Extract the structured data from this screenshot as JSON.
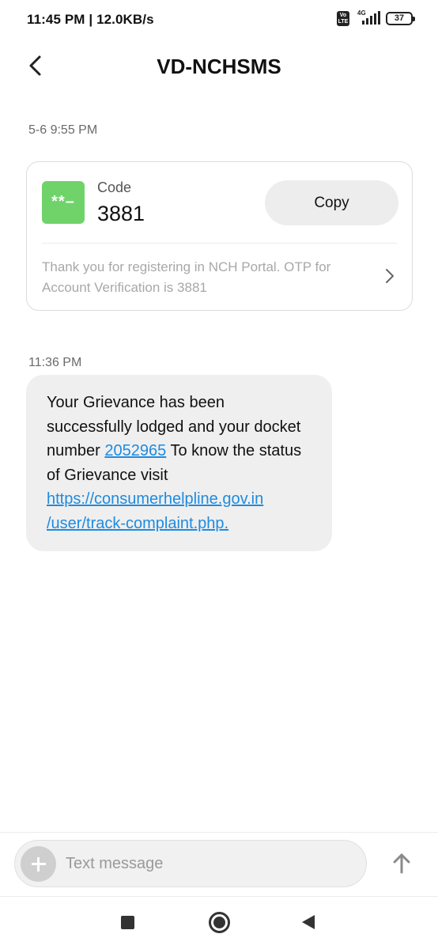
{
  "status_bar": {
    "time_speed": "11:45 PM | 12.0KB/s",
    "volte_label": "Vo LTE",
    "network_label": "4G",
    "battery_level": "37"
  },
  "header": {
    "title": "VD-NCHSMS",
    "back_icon": "chevron-left-icon"
  },
  "messages": [
    {
      "timestamp": "5-6 9:55 PM",
      "otp_card": {
        "icon_text": "**–",
        "icon_color": "#6fd36a",
        "code_label": "Code",
        "code_value": "3881",
        "copy_label": "Copy",
        "body": "Thank you for registering in NCH Portal. OTP for Account Verification is 3881"
      }
    },
    {
      "timestamp": "11:36 PM",
      "text_before_link": "Your Grievance has been successfully lodged and your docket number ",
      "docket_link": "2052965",
      "text_after_link": " To know the status of Grievance visit ",
      "url_line1": "https://consumerhelpline.gov.in",
      "url_line2": "/user/track-complaint.php."
    }
  ],
  "composer": {
    "placeholder": "Text message",
    "add_icon": "plus-icon",
    "send_icon": "arrow-up-icon"
  },
  "colors": {
    "link": "#1e8be0",
    "bubble": "#efefef",
    "otp_icon": "#6fd36a"
  }
}
